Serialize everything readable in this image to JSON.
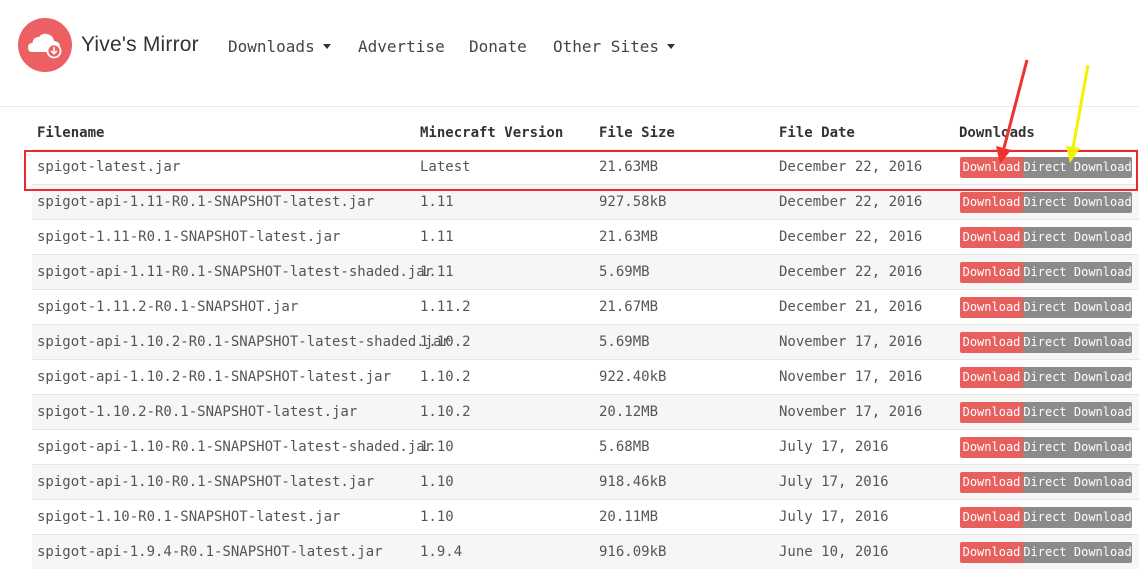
{
  "brand": {
    "name": "Yive's Mirror",
    "logo_icon": "cloud-download-icon",
    "logo_color": "#ec5f63"
  },
  "nav": {
    "downloads": "Downloads",
    "advertise": "Advertise",
    "donate": "Donate",
    "other_sites": "Other Sites"
  },
  "table": {
    "headers": {
      "filename": "Filename",
      "version": "Minecraft Version",
      "size": "File Size",
      "date": "File Date",
      "downloads": "Downloads"
    },
    "download_label": "Download",
    "direct_label": "Direct Download",
    "rows": [
      {
        "name": "spigot-latest.jar",
        "version": "Latest",
        "size": "21.63MB",
        "date": "December 22, 2016"
      },
      {
        "name": "spigot-api-1.11-R0.1-SNAPSHOT-latest.jar",
        "version": "1.11",
        "size": "927.58kB",
        "date": "December 22, 2016"
      },
      {
        "name": "spigot-1.11-R0.1-SNAPSHOT-latest.jar",
        "version": "1.11",
        "size": "21.63MB",
        "date": "December 22, 2016"
      },
      {
        "name": "spigot-api-1.11-R0.1-SNAPSHOT-latest-shaded.jar",
        "version": "1.11",
        "size": "5.69MB",
        "date": "December 22, 2016"
      },
      {
        "name": "spigot-1.11.2-R0.1-SNAPSHOT.jar",
        "version": "1.11.2",
        "size": "21.67MB",
        "date": "December 21, 2016"
      },
      {
        "name": "spigot-api-1.10.2-R0.1-SNAPSHOT-latest-shaded.jar",
        "version": "1.10.2",
        "size": "5.69MB",
        "date": "November 17, 2016"
      },
      {
        "name": "spigot-api-1.10.2-R0.1-SNAPSHOT-latest.jar",
        "version": "1.10.2",
        "size": "922.40kB",
        "date": "November 17, 2016"
      },
      {
        "name": "spigot-1.10.2-R0.1-SNAPSHOT-latest.jar",
        "version": "1.10.2",
        "size": "20.12MB",
        "date": "November 17, 2016"
      },
      {
        "name": "spigot-api-1.10-R0.1-SNAPSHOT-latest-shaded.jar",
        "version": "1.10",
        "size": "5.68MB",
        "date": "July 17, 2016"
      },
      {
        "name": "spigot-api-1.10-R0.1-SNAPSHOT-latest.jar",
        "version": "1.10",
        "size": "918.46kB",
        "date": "July 17, 2016"
      },
      {
        "name": "spigot-1.10-R0.1-SNAPSHOT-latest.jar",
        "version": "1.10",
        "size": "20.11MB",
        "date": "July 17, 2016"
      },
      {
        "name": "spigot-api-1.9.4-R0.1-SNAPSHOT-latest.jar",
        "version": "1.9.4",
        "size": "916.09kB",
        "date": "June 10, 2016"
      }
    ]
  },
  "annotations": {
    "highlight_color": "#e82c2c",
    "red_arrow_color": "#f0312f",
    "yellow_arrow_color": "#f5f200"
  }
}
